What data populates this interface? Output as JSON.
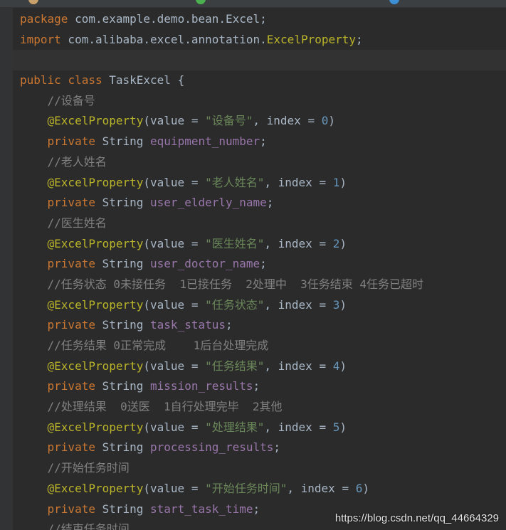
{
  "colors": {
    "background": "#2b2b2b",
    "keyword": "#cc7832",
    "annotation": "#bbb529",
    "string": "#6a8759",
    "number": "#6897bb",
    "field": "#9876aa",
    "comment": "#808080",
    "default": "#a9b7c6"
  },
  "tabbar": {
    "icons": [
      "file-tab-icon",
      "java-class-icon",
      "java-class-icon"
    ]
  },
  "code": {
    "line1": {
      "kw": "package",
      "rest": " com.example.demo.bean.Excel;"
    },
    "line2": {
      "kw": "import",
      "pkg": " com.alibaba.excel.annotation.",
      "cls": "ExcelProperty",
      "semi": ";"
    },
    "line4": {
      "kw1": "public",
      "kw2": "class",
      "name": " TaskExcel {"
    },
    "annotation_name": "@ExcelProperty",
    "annotation_value_key": "(value = ",
    "annotation_index_key": ", index = ",
    "annotation_close": ")",
    "private_kw": "private",
    "string_type": " String ",
    "semicolon": ";",
    "fields": [
      {
        "comment": "//设备号",
        "value": "\"设备号\"",
        "index": "0",
        "name": "equipment_number"
      },
      {
        "comment": "//老人姓名",
        "value": "\"老人姓名\"",
        "index": "1",
        "name": "user_elderly_name"
      },
      {
        "comment": "//医生姓名",
        "value": "\"医生姓名\"",
        "index": "2",
        "name": "user_doctor_name"
      },
      {
        "comment": "//任务状态 0未接任务  1已接任务  2处理中  3任务结束 4任务已超时",
        "value": "\"任务状态\"",
        "index": "3",
        "name": "task_status"
      },
      {
        "comment": "//任务结果 0正常完成    1后台处理完成",
        "value": "\"任务结果\"",
        "index": "4",
        "name": "mission_results"
      },
      {
        "comment": "//处理结果  0送医  1自行处理完毕  2其他",
        "value": "\"处理结果\"",
        "index": "5",
        "name": "processing_results"
      },
      {
        "comment": "//开始任务时间",
        "value": "\"开始任务时间\"",
        "index": "6",
        "name": "start_task_time"
      }
    ],
    "partial_comment": "//结束任务时间"
  },
  "watermark": "https://blog.csdn.net/qq_44664329"
}
